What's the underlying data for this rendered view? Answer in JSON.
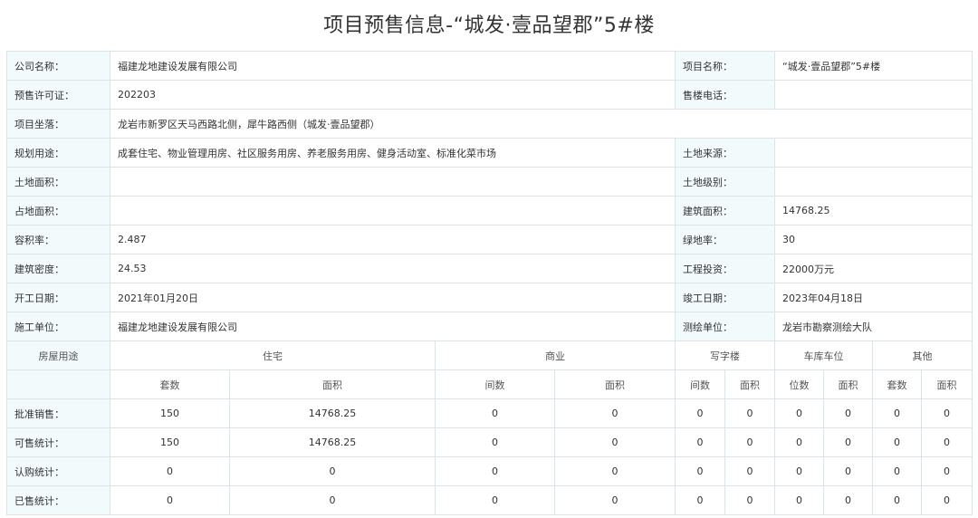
{
  "title": "项目预售信息-“城发·壹品望郡”5#楼",
  "info": {
    "company_label": "公司名称：",
    "company": "福建龙地建设发展有限公司",
    "project_name_label": "项目名称：",
    "project_name": "“城发·壹品望郡”5#楼",
    "permit_label": "预售许可证：",
    "permit": "202203",
    "sales_phone_label": "售楼电话：",
    "sales_phone": "",
    "location_label": "项目坐落：",
    "location": "龙岩市新罗区天马西路北侧，犀牛路西侧（城发·壹品望郡）",
    "usage_label": "规划用途：",
    "usage": "成套住宅、物业管理用房、社区服务用房、养老服务用房、健身活动室、标准化菜市场",
    "land_source_label": "土地来源：",
    "land_source": "",
    "land_area_label": "土地面积：",
    "land_area": "",
    "land_grade_label": "土地级别：",
    "land_grade": "",
    "occupied_area_label": "占地面积：",
    "occupied_area": "",
    "building_area_label": "建筑面积：",
    "building_area": "14768.25",
    "plot_ratio_label": "容积率：",
    "plot_ratio": "2.487",
    "green_ratio_label": "绿地率：",
    "green_ratio": "30",
    "building_density_label": "建筑密度：",
    "building_density": "24.53",
    "investment_label": "工程投资：",
    "investment": "22000万元",
    "start_date_label": "开工日期：",
    "start_date": "2021年01月20日",
    "completion_date_label": "竣工日期：",
    "completion_date": "2023年04月18日",
    "construction_unit_label": "施工单位：",
    "construction_unit": "福建龙地建设发展有限公司",
    "survey_unit_label": "测绘单位：",
    "survey_unit": "龙岩市勘察测绘大队"
  },
  "stats": {
    "usage_header": "房屋用途",
    "groups": [
      "住宅",
      "商业",
      "写字楼",
      "车库车位",
      "其他"
    ],
    "subheaders": [
      "套数",
      "面积",
      "间数",
      "面积",
      "间数",
      "面积",
      "位数",
      "面积",
      "套数",
      "面积"
    ],
    "rows": [
      {
        "label": "批准销售：",
        "values": [
          "150",
          "14768.25",
          "0",
          "0",
          "0",
          "0",
          "0",
          "0",
          "0",
          "0"
        ]
      },
      {
        "label": "可售统计：",
        "values": [
          "150",
          "14768.25",
          "0",
          "0",
          "0",
          "0",
          "0",
          "0",
          "0",
          "0"
        ]
      },
      {
        "label": "认购统计：",
        "values": [
          "0",
          "0",
          "0",
          "0",
          "0",
          "0",
          "0",
          "0",
          "0",
          "0"
        ]
      },
      {
        "label": "已售统计：",
        "values": [
          "0",
          "0",
          "0",
          "0",
          "0",
          "0",
          "0",
          "0",
          "0",
          "0"
        ]
      }
    ]
  }
}
